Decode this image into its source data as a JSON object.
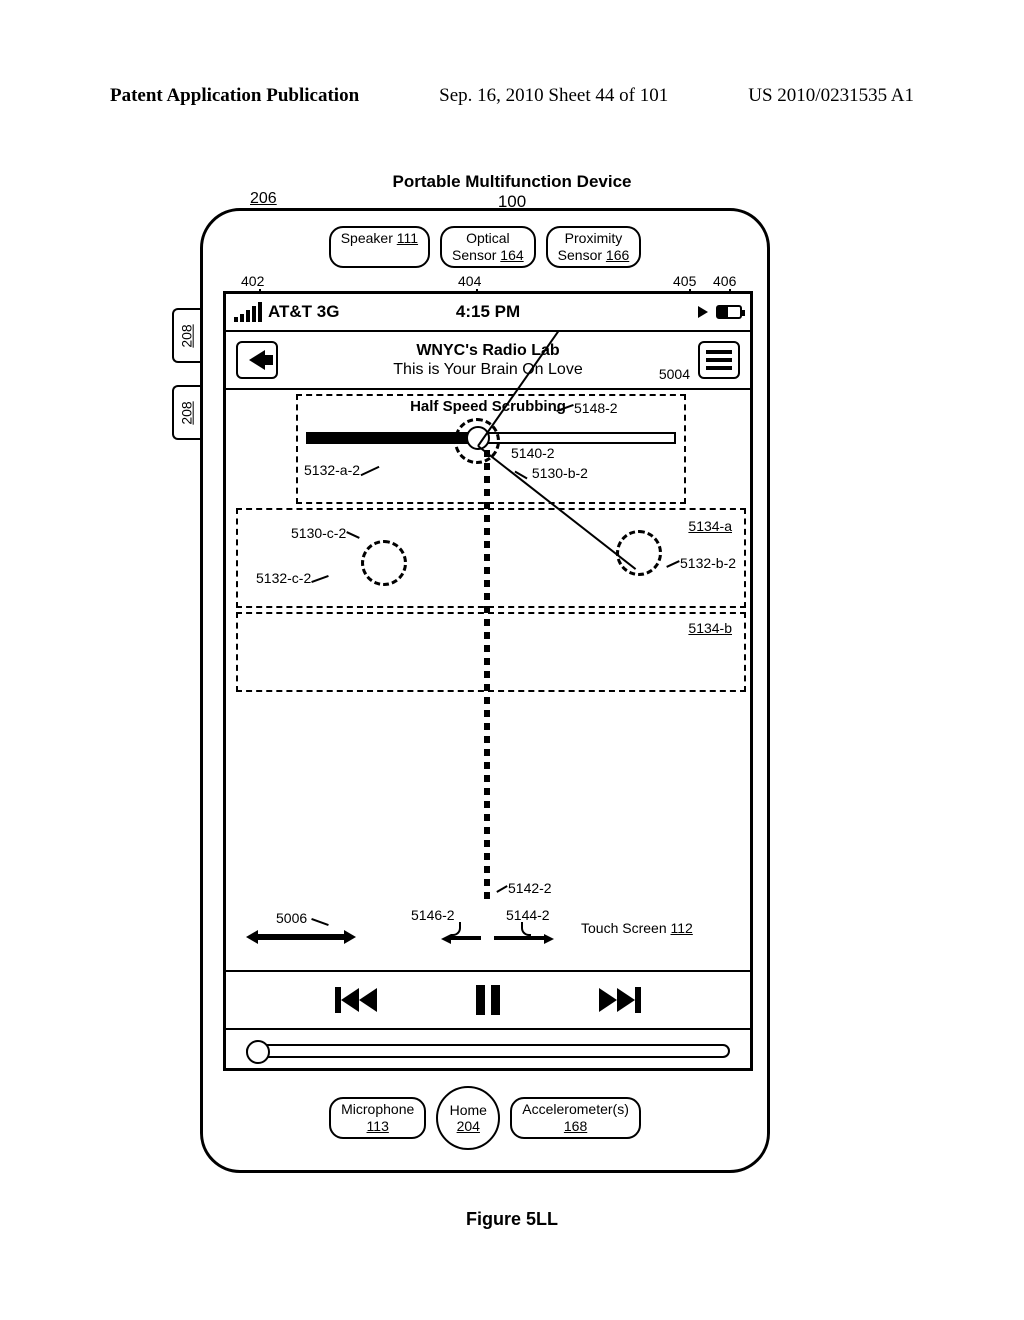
{
  "header": {
    "left": "Patent Application Publication",
    "center": "Sep. 16, 2010  Sheet 44 of 101",
    "right": "US 2010/0231535 A1"
  },
  "device": {
    "title": "Portable Multifunction Device",
    "ref_100": "100",
    "ref_206": "206",
    "ref_208": "208",
    "speaker": "Speaker",
    "speaker_num": "111",
    "optical": "Optical",
    "optical2": "Sensor",
    "optical_num": "164",
    "proximity": "Proximity",
    "proximity2": "Sensor",
    "proximity_num": "166"
  },
  "status": {
    "carrier": "AT&T 3G",
    "time": "4:15 PM",
    "ref_402": "402",
    "ref_404": "404",
    "ref_405": "405",
    "ref_406": "406"
  },
  "nav": {
    "title1": "WNYC's Radio Lab",
    "title2": "This is Your Brain On Love",
    "ref_5004": "5004"
  },
  "scrub": {
    "label": "Half Speed Scrubbing",
    "ref_5148_2": "5148-2",
    "ref_5132_a_2": "5132-a-2",
    "ref_5140_2": "5140-2",
    "ref_5130_b_2": "5130-b-2",
    "ref_5130_c_2": "5130-c-2",
    "ref_5132_c_2": "5132-c-2",
    "ref_5134_a": "5134-a",
    "ref_5132_b_2": "5132-b-2",
    "ref_5134_b": "5134-b",
    "ref_5142_2": "5142-2",
    "ref_5006": "5006",
    "ref_5146_2": "5146-2",
    "ref_5144_2": "5144-2",
    "touch_screen": "Touch Screen",
    "touch_screen_num": "112"
  },
  "bottom": {
    "microphone": "Microphone",
    "microphone_num": "113",
    "home": "Home",
    "home_num": "204",
    "accelerometer": "Accelerometer(s)",
    "accelerometer_num": "168"
  },
  "figure": "Figure 5LL"
}
